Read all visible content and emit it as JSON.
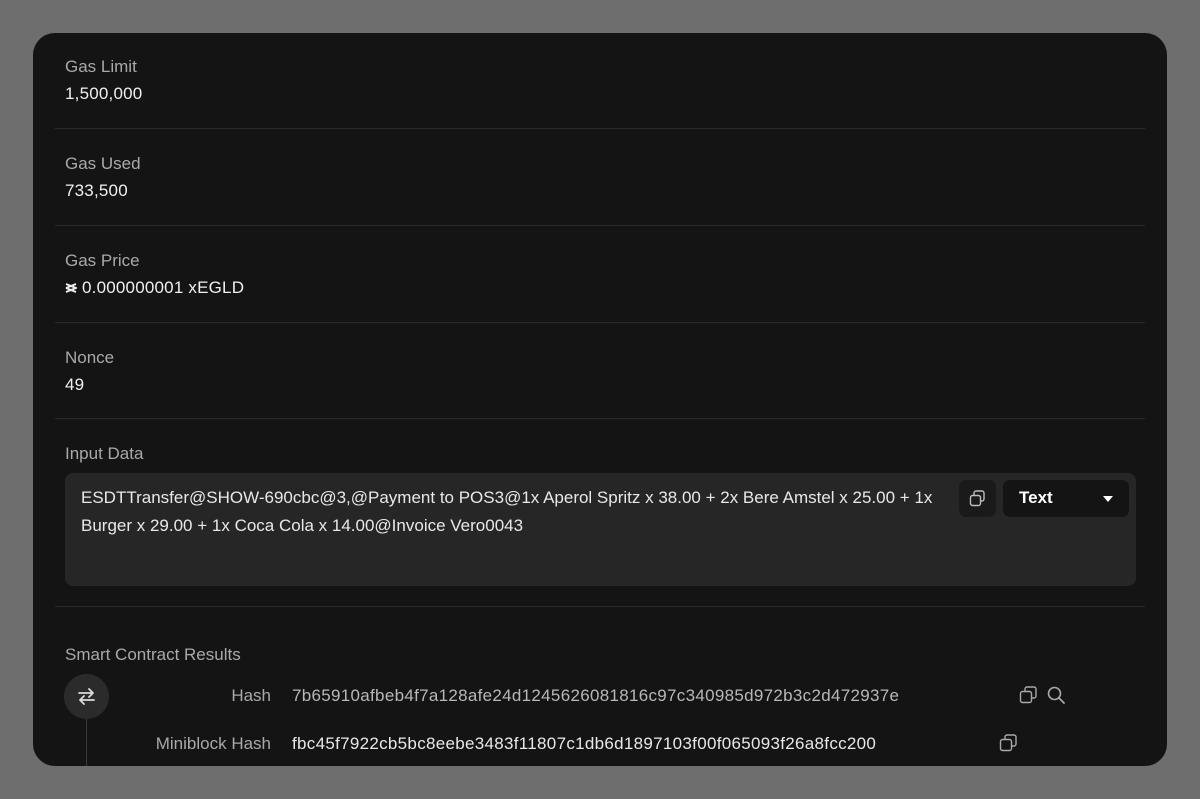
{
  "gas_limit": {
    "label": "Gas Limit",
    "value": "1,500,000"
  },
  "gas_used": {
    "label": "Gas Used",
    "value": "733,500"
  },
  "gas_price": {
    "label": "Gas Price",
    "value": "0.000000001 xEGLD",
    "icon": "egld-icon"
  },
  "nonce": {
    "label": "Nonce",
    "value": "49"
  },
  "input_data": {
    "label": "Input Data",
    "text": "ESDTTransfer@SHOW-690cbc@3,@Payment to POS3@1x Aperol Spritz x 38.00 + 2x Bere Amstel x 25.00 + 1x Burger x 29.00 + 1x Coca Cola x 14.00@Invoice Vero0043",
    "format": "Text"
  },
  "smart_contract_results": {
    "label": "Smart Contract Results",
    "hash_label": "Hash",
    "hash": "7b65910afbeb4f7a128afe24d1245626081816c97c340985d972b3c2d472937e",
    "miniblock_hash_label": "Miniblock Hash",
    "miniblock_hash": "fbc45f7922cb5bc8eebe3483f11807c1db6d1897103f00f065093f26a8fcc200"
  }
}
